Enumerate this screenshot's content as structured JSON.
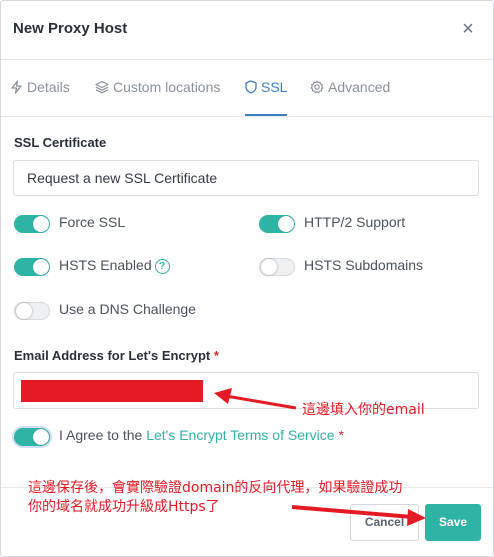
{
  "dialog": {
    "title": "New Proxy Host",
    "close_glyph": "×"
  },
  "tabs": [
    {
      "label": "Details",
      "icon": "lightning-icon",
      "active": false
    },
    {
      "label": "Custom locations",
      "icon": "layers-icon",
      "active": false
    },
    {
      "label": "SSL",
      "icon": "shield-icon",
      "active": true
    },
    {
      "label": "Advanced",
      "icon": "gear-icon",
      "active": false
    }
  ],
  "ssl": {
    "certificate_label": "SSL Certificate",
    "certificate_value": "Request a new SSL Certificate",
    "toggles": {
      "force_ssl": {
        "label": "Force SSL",
        "on": true
      },
      "http2": {
        "label": "HTTP/2 Support",
        "on": true
      },
      "hsts_enabled": {
        "label": "HSTS Enabled",
        "on": true,
        "help_glyph": "?"
      },
      "hsts_subdomains": {
        "label": "HSTS Subdomains",
        "on": false
      },
      "dns_challenge": {
        "label": "Use a DNS Challenge",
        "on": false
      }
    },
    "email_label": "Email Address for Let's Encrypt",
    "required_mark": "*",
    "agree_prefix": "I Agree to the",
    "agree_link": "Let's Encrypt Terms of Service",
    "agree_on": true
  },
  "footer": {
    "cancel_label": "Cancel",
    "save_label": "Save"
  },
  "annotations": {
    "email_note": "這邊填入你的email",
    "save_note_line1": "這邊保存後，會實際驗證domain的反向代理，如果驗證成功",
    "save_note_line2": "你的域名就成功升級成Https了"
  },
  "colors": {
    "accent": "#2fb3a5",
    "tab_active": "#3d7fc8",
    "annotation_red": "#e51a24"
  }
}
